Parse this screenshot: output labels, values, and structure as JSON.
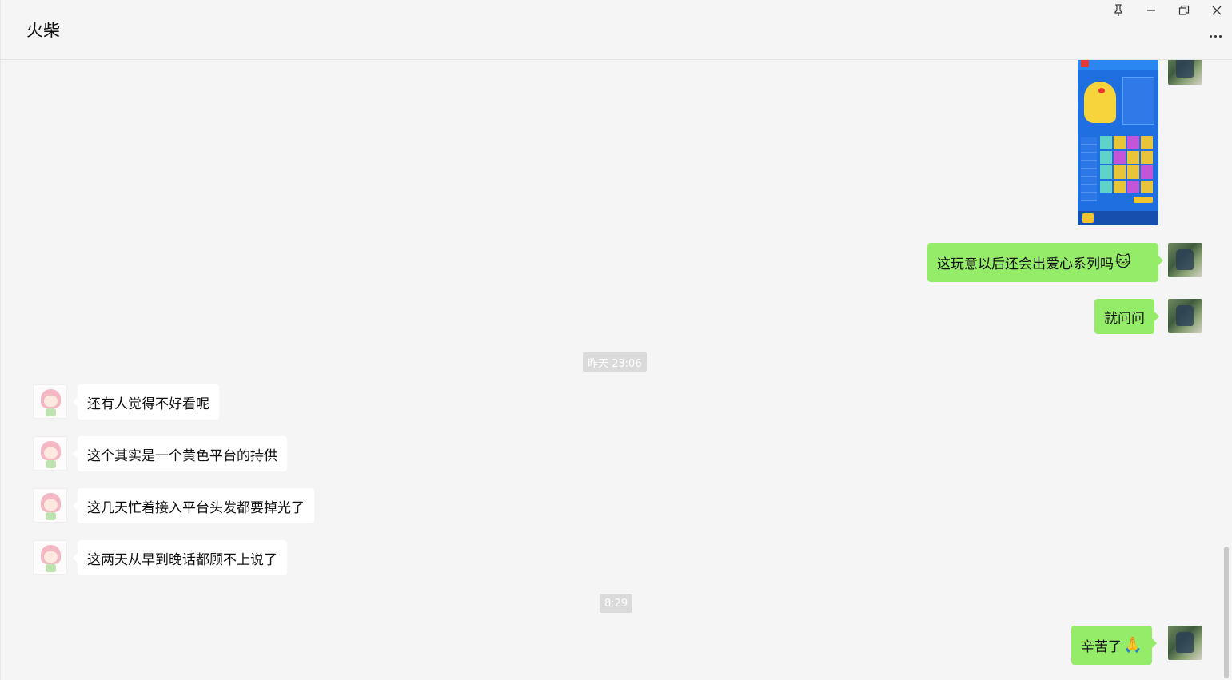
{
  "window": {
    "title": "火柴",
    "controls": [
      "pin-icon",
      "minimize-icon",
      "restore-icon",
      "close-icon"
    ]
  },
  "messages": [
    {
      "sender": "me",
      "type": "image",
      "description": "game-screenshot"
    },
    {
      "sender": "me",
      "type": "text",
      "text": "这玩意以后还会出爱心系列吗",
      "emoji": "🐱"
    },
    {
      "sender": "me",
      "type": "text",
      "text": "就问问"
    },
    {
      "type": "time",
      "text": "昨天 23:06"
    },
    {
      "sender": "other",
      "type": "text",
      "text": "还有人觉得不好看呢"
    },
    {
      "sender": "other",
      "type": "text",
      "text": "这个其实是一个黄色平台的持供"
    },
    {
      "sender": "other",
      "type": "text",
      "text": "这几天忙着接入平台头发都要掉光了"
    },
    {
      "sender": "other",
      "type": "text",
      "text": "这两天从早到晚话都顾不上说了"
    },
    {
      "type": "time",
      "text": "8:29"
    },
    {
      "sender": "me",
      "type": "text",
      "text": "辛苦了",
      "emoji": "🙏"
    }
  ],
  "colors": {
    "my_bubble": "#95ec69",
    "other_bubble": "#ffffff",
    "background": "#f5f5f5",
    "timestamp_bg": "#dadada"
  }
}
